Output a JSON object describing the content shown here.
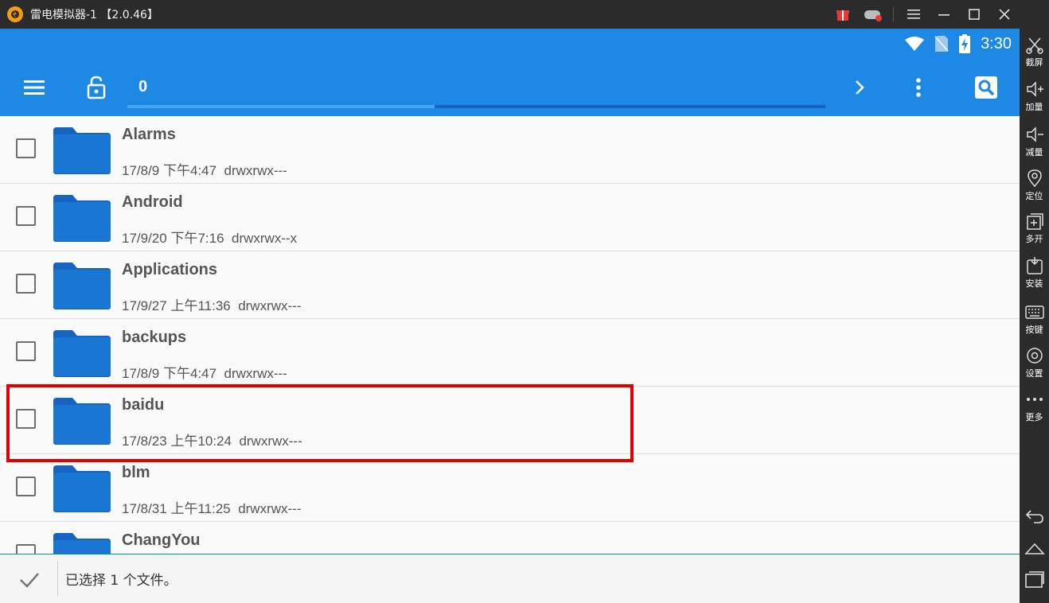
{
  "window": {
    "title": "雷电模拟器-1 【2.0.46】"
  },
  "statusbar": {
    "time": "3:30"
  },
  "toolbar": {
    "path": "0",
    "progress": 0.44
  },
  "files": [
    {
      "name": "Alarms",
      "date": "17/8/9 下午4:47",
      "perm": "drwxrwx---"
    },
    {
      "name": "Android",
      "date": "17/9/20 下午7:16",
      "perm": "drwxrwx--x"
    },
    {
      "name": "Applications",
      "date": "17/9/27 上午11:36",
      "perm": "drwxrwx---"
    },
    {
      "name": "backups",
      "date": "17/8/9 下午4:47",
      "perm": "drwxrwx---"
    },
    {
      "name": "baidu",
      "date": "17/8/23 上午10:24",
      "perm": "drwxrwx---"
    },
    {
      "name": "blm",
      "date": "17/8/31 上午11:25",
      "perm": "drwxrwx---"
    },
    {
      "name": "ChangYou",
      "date": "",
      "perm": ""
    }
  ],
  "bottombar": {
    "selection_text": "已选择 1 个文件。"
  },
  "sidebar": {
    "items": [
      {
        "label": "截屏",
        "icon": "scissors-icon"
      },
      {
        "label": "加量",
        "icon": "volume-up-icon"
      },
      {
        "label": "减量",
        "icon": "volume-down-icon"
      },
      {
        "label": "定位",
        "icon": "location-icon"
      },
      {
        "label": "多开",
        "icon": "multi-instance-icon"
      },
      {
        "label": "安装",
        "icon": "apk-install-icon"
      },
      {
        "label": "按键",
        "icon": "keyboard-icon"
      },
      {
        "label": "设置",
        "icon": "gear-icon"
      },
      {
        "label": "更多",
        "icon": "more-dots-icon"
      }
    ]
  },
  "colors": {
    "accent": "#1e88e5",
    "folder": "#1976d2",
    "highlight": "#e00000"
  }
}
